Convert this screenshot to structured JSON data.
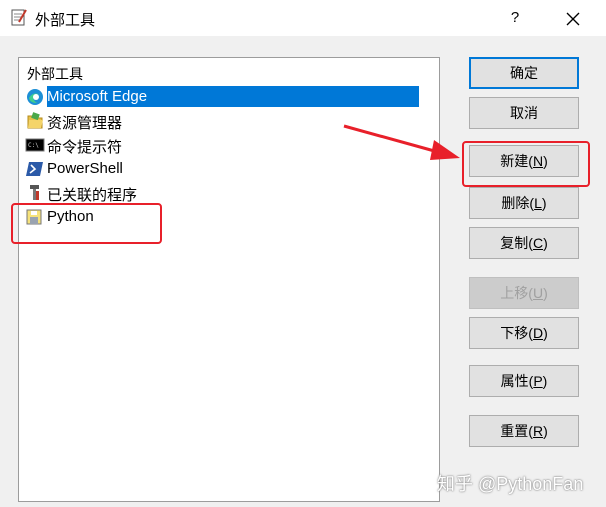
{
  "window": {
    "title": "外部工具",
    "help_label": "?",
    "close_label": "✕"
  },
  "list": {
    "header": "外部工具",
    "items": [
      {
        "label": "Microsoft Edge",
        "icon": "edge-icon",
        "selected": true
      },
      {
        "label": "资源管理器",
        "icon": "folder-icon",
        "selected": false
      },
      {
        "label": "命令提示符",
        "icon": "cmd-icon",
        "selected": false
      },
      {
        "label": "PowerShell",
        "icon": "powershell-icon",
        "selected": false
      },
      {
        "label": "已关联的程序",
        "icon": "tools-icon",
        "selected": false
      },
      {
        "label": "Python",
        "icon": "python-icon",
        "selected": false
      }
    ]
  },
  "buttons": {
    "ok": {
      "text": "确定"
    },
    "cancel": {
      "text": "取消"
    },
    "new": {
      "text": "新建(",
      "key": "N",
      "end": ")"
    },
    "delete": {
      "text": "删除(",
      "key": "L",
      "end": ")"
    },
    "copy": {
      "text": "复制(",
      "key": "C",
      "end": ")"
    },
    "move_up": {
      "text": "上移(",
      "key": "U",
      "end": ")",
      "disabled": true
    },
    "move_down": {
      "text": "下移(",
      "key": "D",
      "end": ")"
    },
    "properties": {
      "text": "属性(",
      "key": "P",
      "end": ")"
    },
    "reset": {
      "text": "重置(",
      "key": "R",
      "end": ")"
    }
  },
  "watermark": "知乎 @PythonFan",
  "colors": {
    "selection": "#0078d7",
    "annotation_red": "#e8202a"
  }
}
